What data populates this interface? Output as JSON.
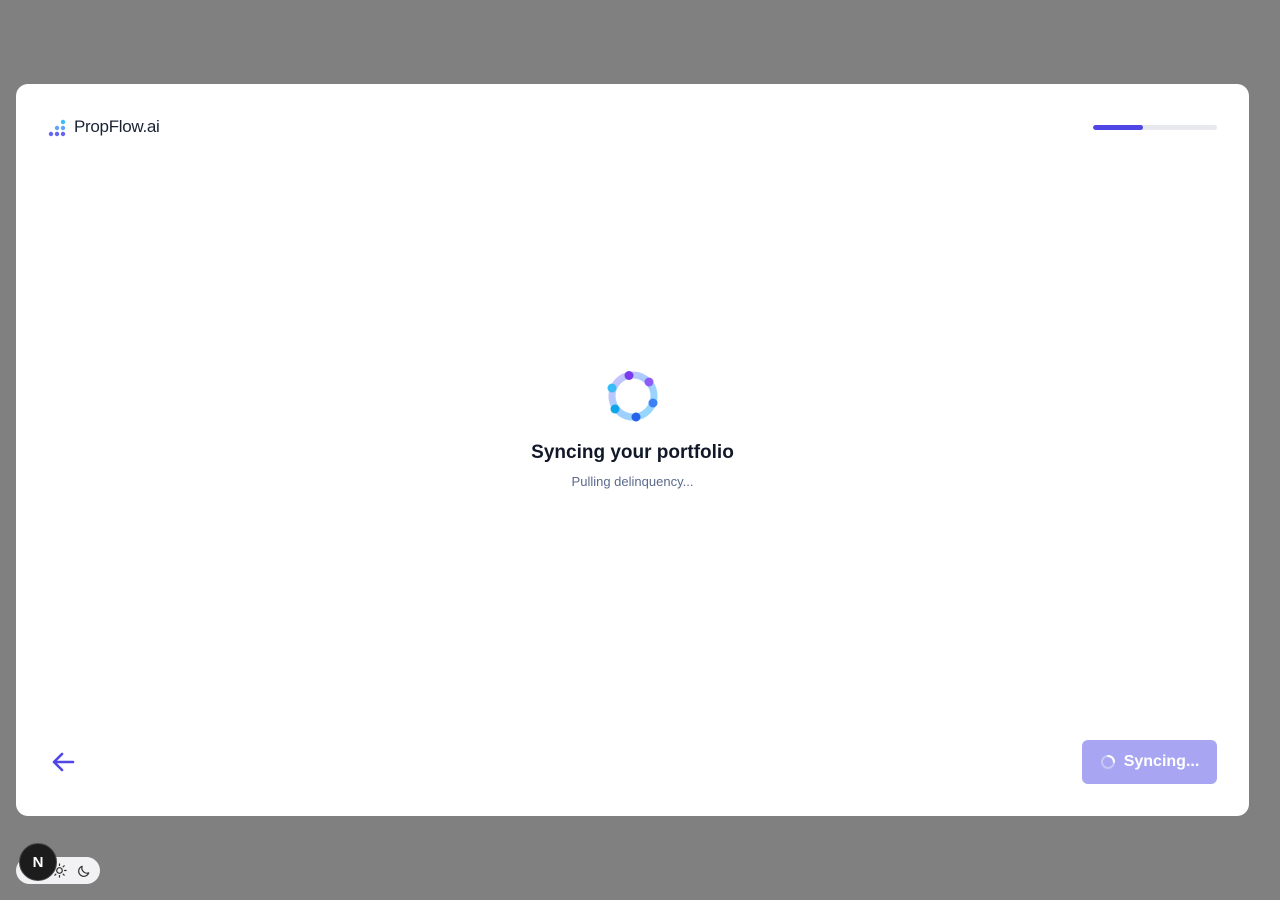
{
  "header": {
    "logo_text": "PropFlow.ai",
    "progress_fraction": 0.4
  },
  "main": {
    "title": "Syncing your portfolio",
    "status": "Pulling delinquency..."
  },
  "footer": {
    "back_icon": "arrow-left-icon",
    "sync_button_label": "Syncing..."
  },
  "devtools": {
    "badge_letter": "N",
    "theme_icons": [
      "sun-icon",
      "moon-icon"
    ]
  },
  "colors": {
    "accent": "#4f46e5",
    "button_disabled": "#a8a6f2",
    "overlay": "#808080"
  }
}
